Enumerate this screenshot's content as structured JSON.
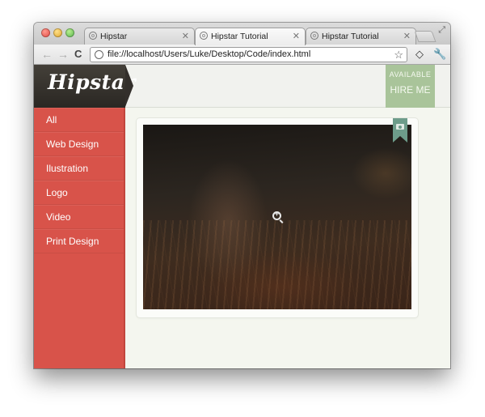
{
  "browser": {
    "tabs": [
      {
        "title": "Hipstar",
        "active": false
      },
      {
        "title": "Hipstar Tutorial",
        "active": true
      },
      {
        "title": "Hipstar Tutorial",
        "active": false
      }
    ],
    "url": "file://localhost/Users/Luke/Desktop/Code/index.html"
  },
  "site": {
    "logo": "Hipstar",
    "hire_badge": {
      "line1": "AVAILABLE",
      "line2": "HIRE ME"
    },
    "nav": [
      {
        "label": "All"
      },
      {
        "label": "Web Design"
      },
      {
        "label": "Ilustration"
      },
      {
        "label": "Logo"
      },
      {
        "label": "Video"
      },
      {
        "label": "Print Design"
      }
    ]
  },
  "colors": {
    "sidebar": "#d8534a",
    "logo_bg": "#332f2b",
    "ribbon": "#a9c49a",
    "camera_ribbon": "#6d9c8a",
    "page_bg": "#f4f6ef"
  },
  "icons": {
    "photo_overlay": "zoom-in-icon",
    "category_badge": "camera-icon"
  }
}
